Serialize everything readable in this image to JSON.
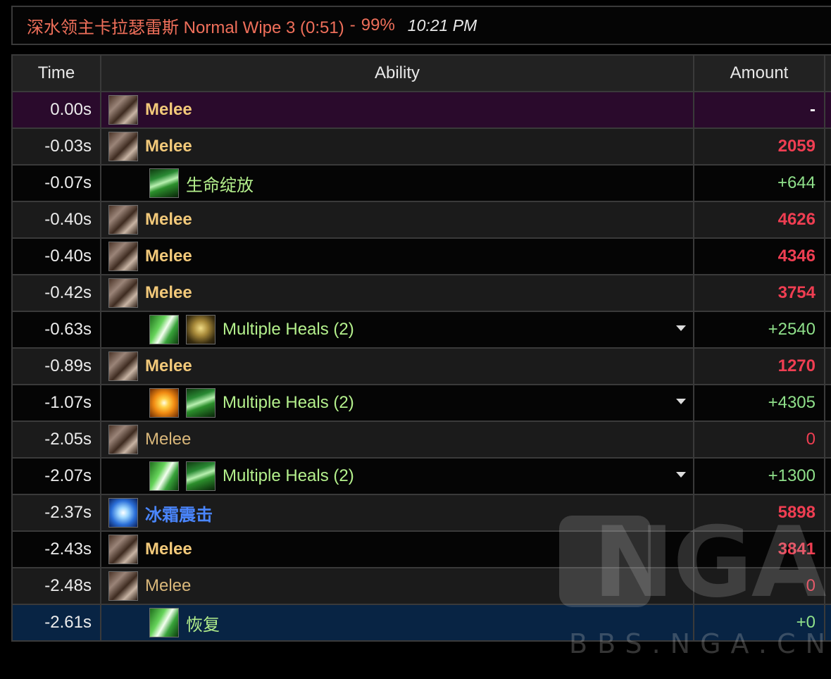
{
  "header": {
    "title": "深水领主卡拉瑟雷斯 Normal Wipe 3 (0:51)",
    "separator": "-",
    "percent": "99%",
    "clock": "10:21 PM"
  },
  "columns": {
    "time": "Time",
    "ability": "Ability",
    "amount": "Amount"
  },
  "rows": [
    {
      "time": "0.00s",
      "icons": [
        "melee-icon"
      ],
      "ability": "Melee",
      "amount": "-"
    },
    {
      "time": "-0.03s",
      "icons": [
        "melee-icon"
      ],
      "ability": "Melee",
      "amount": "2059"
    },
    {
      "time": "-0.07s",
      "icons": [
        "lifebloom-icon"
      ],
      "ability": "生命绽放",
      "amount": "+644"
    },
    {
      "time": "-0.40s",
      "icons": [
        "melee-icon"
      ],
      "ability": "Melee",
      "amount": "4626"
    },
    {
      "time": "-0.40s",
      "icons": [
        "melee-icon"
      ],
      "ability": "Melee",
      "amount": "4346"
    },
    {
      "time": "-0.42s",
      "icons": [
        "melee-icon"
      ],
      "ability": "Melee",
      "amount": "3754"
    },
    {
      "time": "-0.63s",
      "icons": [
        "heal-swipe-icon",
        "totem-icon"
      ],
      "ability": "Multiple Heals (2)",
      "amount": "+2540"
    },
    {
      "time": "-0.89s",
      "icons": [
        "melee-icon"
      ],
      "ability": "Melee",
      "amount": "1270"
    },
    {
      "time": "-1.07s",
      "icons": [
        "holy-burst-icon",
        "lifebloom-icon"
      ],
      "ability": "Multiple Heals (2)",
      "amount": "+4305"
    },
    {
      "time": "-2.05s",
      "icons": [
        "melee-icon"
      ],
      "ability": "Melee",
      "amount": "0"
    },
    {
      "time": "-2.07s",
      "icons": [
        "heal-swipe-icon",
        "lifebloom-icon"
      ],
      "ability": "Multiple Heals (2)",
      "amount": "+1300"
    },
    {
      "time": "-2.37s",
      "icons": [
        "frost-shock-icon"
      ],
      "ability": "冰霜震击",
      "amount": "5898"
    },
    {
      "time": "-2.43s",
      "icons": [
        "melee-icon"
      ],
      "ability": "Melee",
      "amount": "3841"
    },
    {
      "time": "-2.48s",
      "icons": [
        "melee-icon"
      ],
      "ability": "Melee",
      "amount": "0"
    },
    {
      "time": "-2.61s",
      "icons": [
        "heal-swipe-icon"
      ],
      "ability": "恢复",
      "amount": "+0"
    }
  ],
  "watermark": {
    "logo": "NGA",
    "url": "BBS.NGA.CN"
  },
  "colors": {
    "header_text": "#ef6f5a",
    "damage": "#ef3e52",
    "heal": "#8fe08a",
    "melee_name": "#f2c97a",
    "heal_name": "#b4f08c",
    "frost_name": "#4a86ff",
    "row_highlight_first": "#2a0a2c",
    "row_highlight_last": "#082444"
  }
}
